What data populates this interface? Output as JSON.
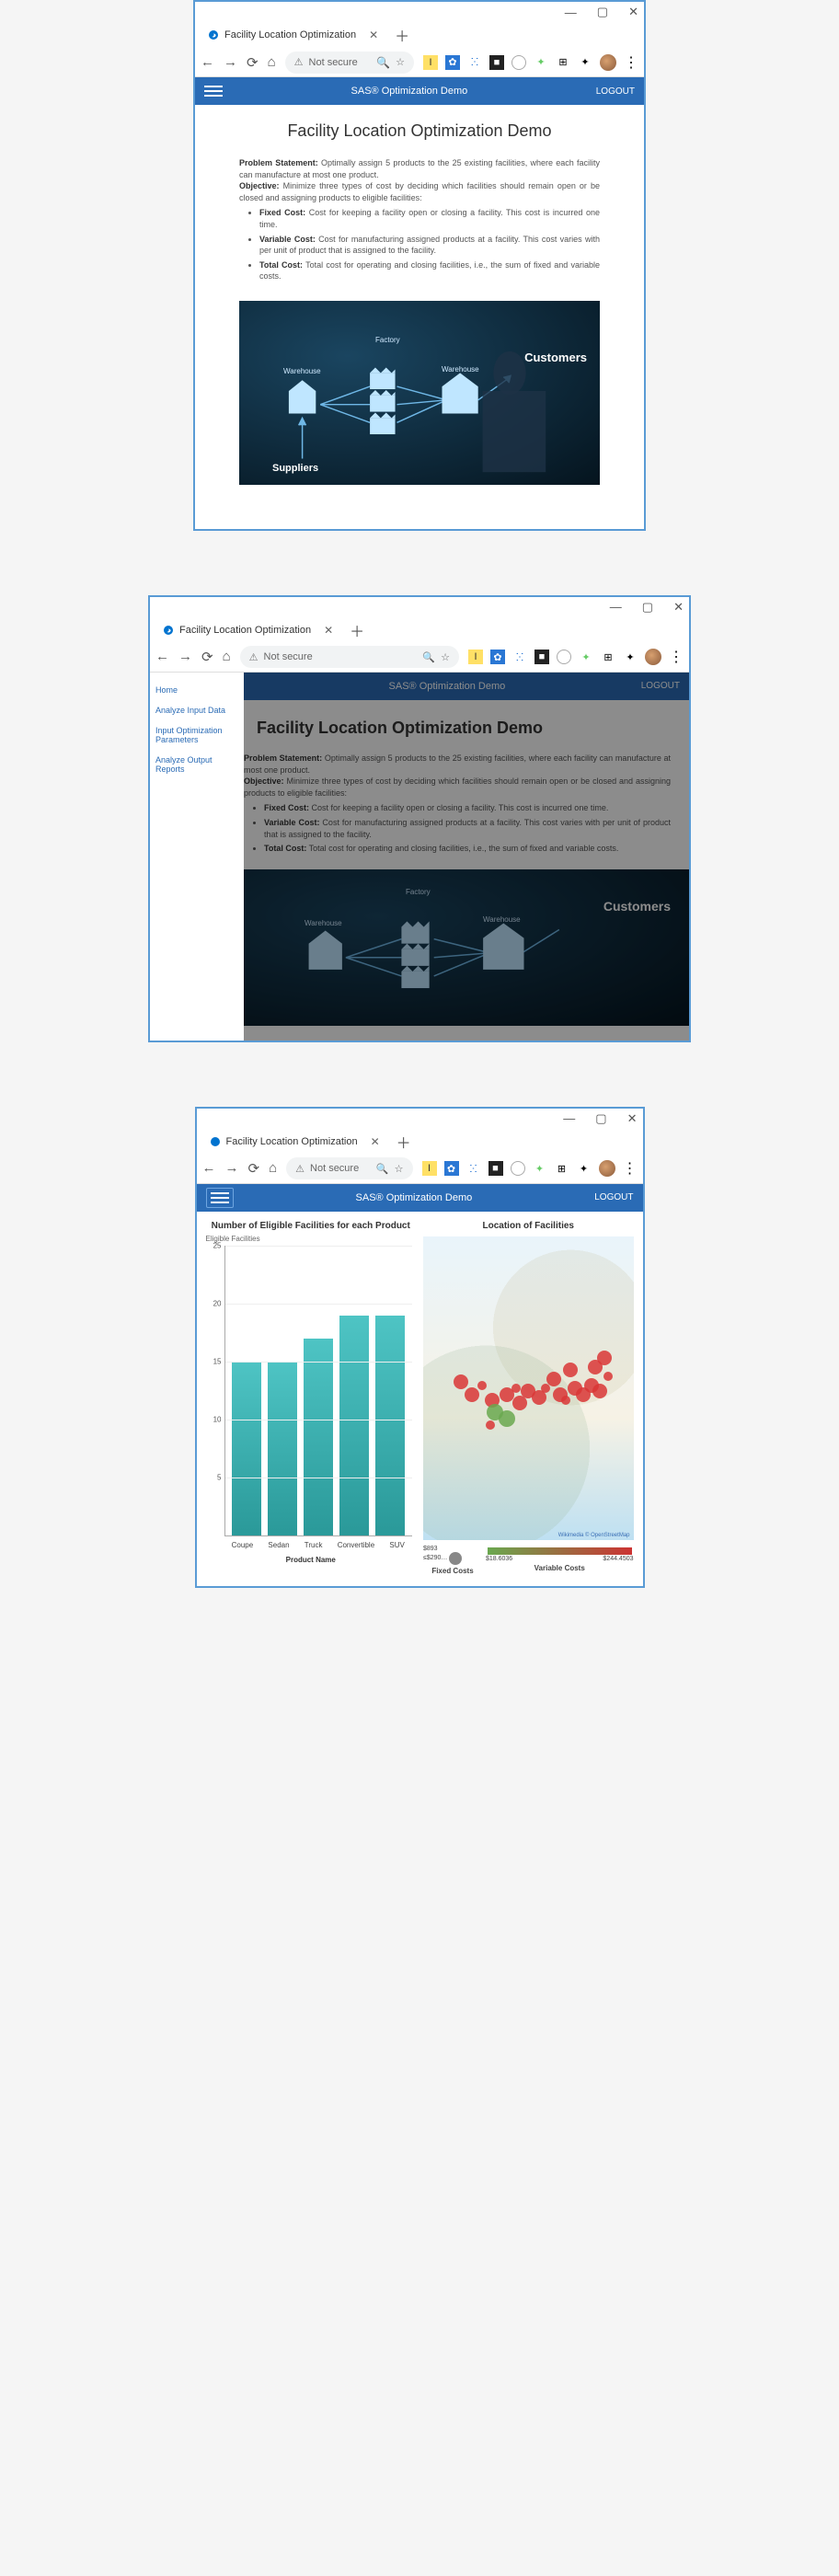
{
  "browser": {
    "tab_title": "Facility Location Optimization",
    "security_text": "Not secure"
  },
  "header": {
    "title": "SAS® Optimization Demo",
    "logout": "LOGOUT"
  },
  "page": {
    "title": "Facility Location Optimization Demo",
    "problem_label": "Problem Statement:",
    "problem_text": " Optimally assign 5 products to the 25 existing facilities, where each facility can manufacture at most one product.",
    "objective_label": "Objective:",
    "objective_text": " Minimize three types of cost by deciding which facilities should remain open or be closed and assigning products to eligible facilities:",
    "fixed_label": "Fixed Cost:",
    "fixed_text": " Cost for keeping a facility open or closing a facility. This cost is incurred one time.",
    "variable_label": "Variable Cost:",
    "variable_text": " Cost for manufacturing assigned products at a facility. This cost varies with per unit of product that is assigned to the facility.",
    "total_label": "Total Cost:",
    "total_text": " Total cost for operating and closing facilities, i.e., the sum of fixed and variable costs.",
    "illus": {
      "suppliers": "Suppliers",
      "warehouse": "Warehouse",
      "factory": "Factory",
      "customers": "Customers"
    }
  },
  "sidebar": {
    "home": "Home",
    "analyze_input": "Analyze Input Data",
    "input_params": "Input Optimization Parameters",
    "analyze_output": "Analyze Output Reports"
  },
  "screen3": {
    "bar_title": "Number of Eligible Facilities for each Product",
    "map_title": "Location of Facilities",
    "y_label": "Eligible Facilities",
    "x_label": "Product Name",
    "legend_fixed": "Fixed Costs",
    "legend_variable": "Variable Costs",
    "fixed_value": "$893",
    "fixed_low": "≤$290…",
    "var_low": "$18.6036",
    "var_high": "$244.4503",
    "map_attr": "Wikimedia © OpenStreetMap"
  },
  "chart_data": {
    "type": "bar",
    "categories": [
      "Coupe",
      "Sedan",
      "Truck",
      "Convertible",
      "SUV"
    ],
    "values": [
      15,
      15,
      17,
      19,
      19
    ],
    "ylabel": "Eligible Facilities",
    "xlabel": "Product Name",
    "title": "Number of Eligible Facilities for each Product",
    "ylim": [
      0,
      25
    ],
    "yticks": [
      5,
      10,
      15,
      20,
      25
    ]
  }
}
